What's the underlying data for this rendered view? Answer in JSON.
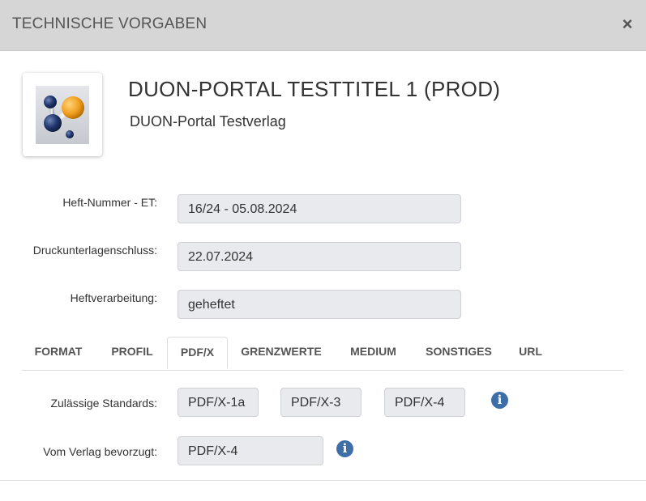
{
  "modal": {
    "title": "TECHNISCHE VORGABEN",
    "close_label": "×"
  },
  "publication": {
    "title": "DUON-PORTAL TESTTITEL 1 (PROD)",
    "publisher": "DUON-Portal Testverlag",
    "logo_icon": "molecule-logo-icon"
  },
  "fields": {
    "heft_nummer": {
      "label": "Heft-Nummer - ET:",
      "value": "16/24 - 05.08.2024"
    },
    "druckunterlagenschluss": {
      "label": "Druckunterlagenschluss:",
      "value": "22.07.2024"
    },
    "heftverarbeitung": {
      "label": "Heftverarbeitung:",
      "value": "geheftet"
    }
  },
  "tabs": [
    {
      "label": "FORMAT",
      "active": false
    },
    {
      "label": "PROFIL",
      "active": false
    },
    {
      "label": "PDF/X",
      "active": true
    },
    {
      "label": "GRENZWERTE",
      "active": false
    },
    {
      "label": "MEDIUM",
      "active": false
    },
    {
      "label": "SONSTIGES",
      "active": false
    },
    {
      "label": "URL",
      "active": false
    }
  ],
  "pdfx": {
    "standards_label": "Zulässige Standards:",
    "standards": [
      "PDF/X-1a",
      "PDF/X-3",
      "PDF/X-4"
    ],
    "preferred_label": "Vom Verlag bevorzugt:",
    "preferred_value": "PDF/X-4",
    "info_glyph": "i"
  },
  "colors": {
    "header_bg": "#d6d6d6",
    "field_bg": "#e9eaed",
    "info_icon": "#3e6ea8"
  }
}
